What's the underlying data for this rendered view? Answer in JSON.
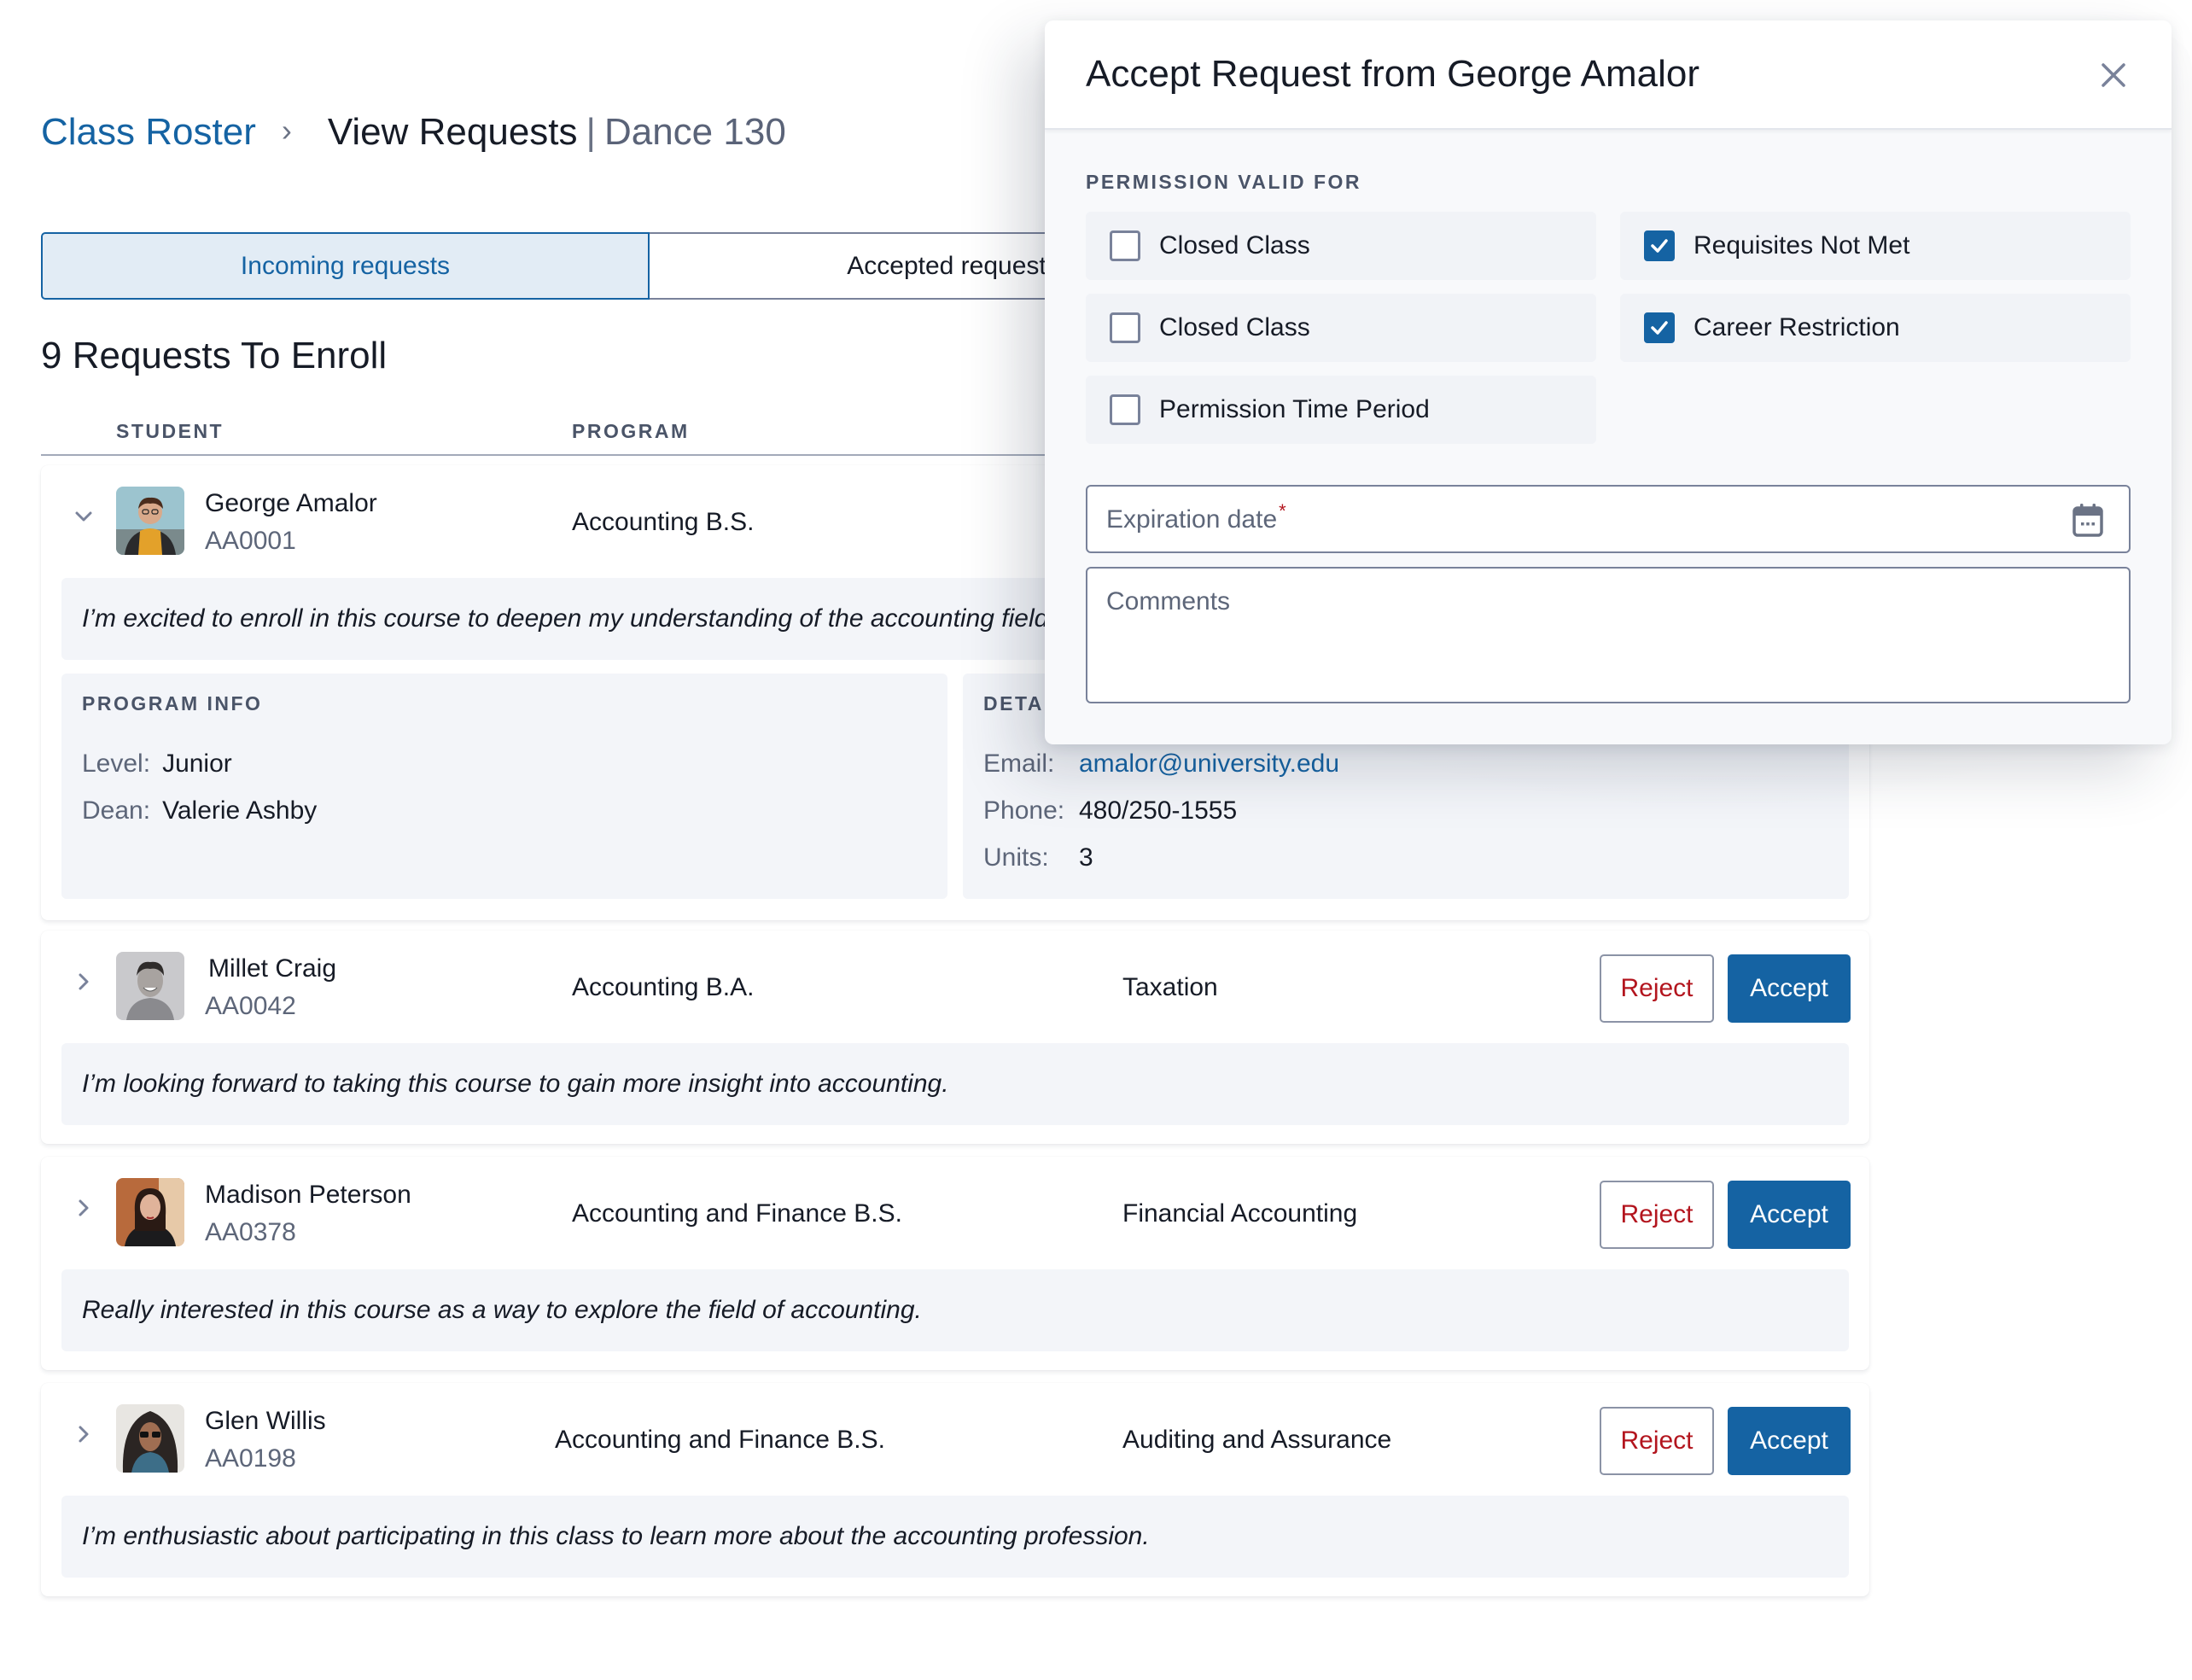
{
  "breadcrumb": {
    "parent": "Class Roster",
    "separator": "›",
    "current": "View Requests",
    "divider": "|",
    "course": "Dance 130"
  },
  "tabs": [
    {
      "label": "Incoming requests",
      "active": true
    },
    {
      "label": "Accepted requests",
      "active": false
    }
  ],
  "section_title": "9 Requests To Enroll",
  "table": {
    "headers": {
      "student": "STUDENT",
      "program": "PROGRAM"
    }
  },
  "requests": [
    {
      "name": "George Amalor",
      "id": "AA0001",
      "program": "Accounting B.S.",
      "course": "",
      "expanded": true,
      "message": "I’m excited to enroll in this course to deepen my understanding of the accounting field.",
      "program_info": {
        "title": "PROGRAM INFO",
        "level_label": "Level:",
        "level": "Junior",
        "dean_label": "Dean:",
        "dean": "Valerie Ashby"
      },
      "details": {
        "title": "DETAILS",
        "email_label": "Email:",
        "email": "amalor@university.edu",
        "phone_label": "Phone:",
        "phone": "480/250-1555",
        "units_label": "Units:",
        "units": "3"
      }
    },
    {
      "name": "Millet Craig",
      "id": "AA0042",
      "program": "Accounting B.A.",
      "course": "Taxation",
      "expanded": false,
      "message": "I’m looking forward to taking this course to gain more insight into accounting."
    },
    {
      "name": "Madison Peterson",
      "id": "AA0378",
      "program": "Accounting and Finance B.S.",
      "course": "Financial Accounting",
      "expanded": false,
      "message": "Really interested in this course as a way to explore the field of accounting."
    },
    {
      "name": "Glen Willis",
      "id": "AA0198",
      "program": "Accounting and Finance B.S.",
      "course": "Auditing and Assurance",
      "expanded": false,
      "message": "I’m enthusiastic about participating in this class to learn more about the accounting profession."
    }
  ],
  "actions": {
    "reject": "Reject",
    "accept": "Accept"
  },
  "dialog": {
    "title": "Accept Request from George Amalor",
    "permission_label": "PERMISSION VALID FOR",
    "permissions": [
      {
        "label": "Closed Class",
        "checked": false
      },
      {
        "label": "Requisites Not Met",
        "checked": true
      },
      {
        "label": "Closed Class",
        "checked": false
      },
      {
        "label": "Career Restriction",
        "checked": true
      },
      {
        "label": "Permission Time Period",
        "checked": false
      }
    ],
    "expiration_placeholder": "Expiration date",
    "required_mark": "*",
    "comments_placeholder": "Comments"
  },
  "colors": {
    "primary": "#1563a3",
    "danger": "#b3151e",
    "muted": "#5d6679",
    "panel": "#f3f5f9"
  },
  "icons": {
    "breadcrumb_separator": "chevron-right-icon",
    "expand_open": "chevron-down-icon",
    "expand_closed": "chevron-right-icon",
    "close": "close-icon",
    "calendar": "calendar-icon",
    "check": "checkmark-icon"
  }
}
